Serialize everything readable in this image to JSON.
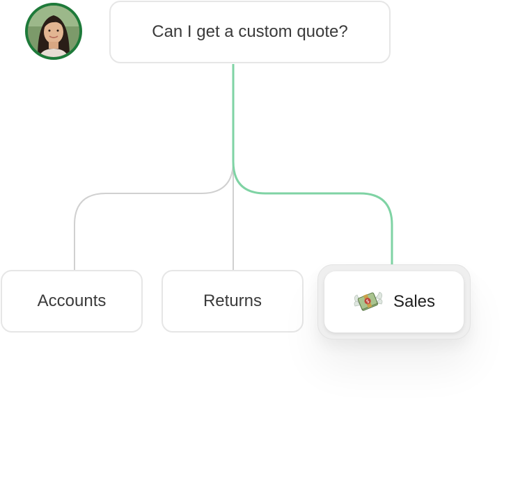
{
  "user": {
    "avatar_icon": "user-avatar-photo"
  },
  "question": {
    "text": "Can I get a custom quote?"
  },
  "routes": [
    {
      "label": "Accounts",
      "selected": false
    },
    {
      "label": "Returns",
      "selected": false
    },
    {
      "label": "Sales",
      "selected": true,
      "icon": "money-with-wings-icon"
    }
  ],
  "colors": {
    "connector": "#d0d0d0",
    "active_connector": "#7fd3a4",
    "avatar_ring": "#1e7a3a",
    "border": "#e6e6e6"
  }
}
